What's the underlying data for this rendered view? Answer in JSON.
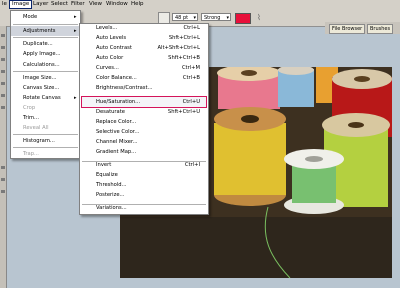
{
  "menubar": {
    "items": [
      "le",
      "Image",
      "Layer",
      "Select",
      "Filter",
      "View",
      "Window",
      "Help"
    ]
  },
  "options_bar": {
    "font_size": "48 pt",
    "aa_mode": "Strong",
    "text_color": "#e8103a"
  },
  "palette_well": {
    "tabs": [
      "File Browser",
      "Brushes"
    ]
  },
  "image_menu": {
    "items": [
      {
        "label": "Mode",
        "submenu": true
      },
      {
        "label": "Adjustments",
        "submenu": true,
        "highlighted": true
      },
      {
        "label": "Duplicate..."
      },
      {
        "label": "Apply Image..."
      },
      {
        "label": "Calculations..."
      },
      {
        "label": "Image Size..."
      },
      {
        "label": "Canvas Size..."
      },
      {
        "label": "Rotate Canvas",
        "submenu": true
      },
      {
        "label": "Crop",
        "disabled": true
      },
      {
        "label": "Trim..."
      },
      {
        "label": "Reveal All",
        "disabled": true
      },
      {
        "label": "Histogram..."
      },
      {
        "label": "Trap...",
        "disabled": true
      }
    ]
  },
  "adjustments_menu": {
    "items": [
      {
        "label": "Levels...",
        "shortcut": "Ctrl+L"
      },
      {
        "label": "Auto Levels",
        "shortcut": "Shft+Ctrl+L"
      },
      {
        "label": "Auto Contrast",
        "shortcut": "Alt+Shft+Ctrl+L"
      },
      {
        "label": "Auto Color",
        "shortcut": "Shft+Ctrl+B"
      },
      {
        "label": "Curves...",
        "shortcut": "Ctrl+M"
      },
      {
        "label": "Color Balance...",
        "shortcut": "Ctrl+B"
      },
      {
        "label": "Brightness/Contrast...",
        "shortcut": ""
      },
      {
        "label": "Hue/Saturation...",
        "shortcut": "Ctrl+U",
        "selected": true
      },
      {
        "label": "Desaturate",
        "shortcut": "Shft+Ctrl+U"
      },
      {
        "label": "Replace Color...",
        "shortcut": ""
      },
      {
        "label": "Selective Color...",
        "shortcut": ""
      },
      {
        "label": "Channel Mixer...",
        "shortcut": ""
      },
      {
        "label": "Gradient Map...",
        "shortcut": ""
      },
      {
        "label": "Invert",
        "shortcut": "Ctrl+I"
      },
      {
        "label": "Equalize",
        "shortcut": ""
      },
      {
        "label": "Threshold...",
        "shortcut": ""
      },
      {
        "label": "Posterize...",
        "shortcut": ""
      },
      {
        "label": "Variations...",
        "shortcut": ""
      }
    ],
    "selection_outline_color": "#d4145a"
  }
}
